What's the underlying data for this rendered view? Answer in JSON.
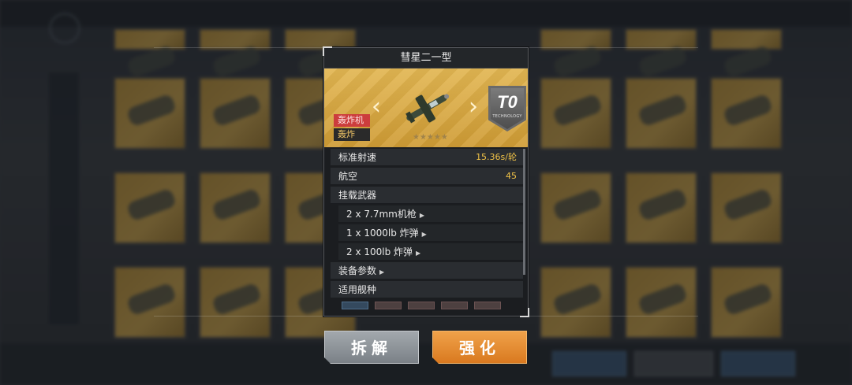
{
  "popup": {
    "title": "彗星二一型",
    "tier": "T0",
    "tier_subtitle": "TECHNOLOGY",
    "tags": [
      "轰炸机",
      "轰炸"
    ],
    "stars": "★★★★★",
    "stats": [
      {
        "label": "标准射速",
        "value": "15.36s/轮"
      },
      {
        "label": "航空",
        "value": "45"
      }
    ],
    "weapons_header": "挂载武器",
    "weapons": [
      "2 x 7.7mm机枪",
      "1 x 1000lb 炸弹",
      "2 x 100lb 炸弹"
    ],
    "equip_params": "装备参数",
    "applicable_ships": "适用舰种"
  },
  "buttons": {
    "dismantle": "拆解",
    "enhance": "强化"
  },
  "colors": {
    "accent_gold": "#f0c247",
    "enhance_orange": "#e08a2c",
    "dismantle_gray": "#8e9399"
  },
  "icons": {
    "prev": "chevron-left-icon",
    "next": "chevron-right-icon",
    "submenu": "triangle-right-icon"
  }
}
